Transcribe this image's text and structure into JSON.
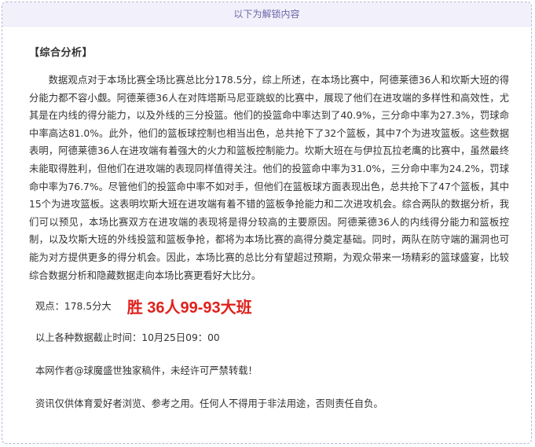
{
  "unlock_banner": "以下为解锁内容",
  "section_title": "【综合分析】",
  "analysis_paragraph": "数据观点对于本场比赛全场比赛总比分178.5分，综上所述，在本场比赛中，阿德莱德36人和坎斯大班的得分能力都不容小觑。阿德莱德36人在对阵塔斯马尼亚跳蚁的比赛中，展现了他们在进攻端的多样性和高效性，尤其是在内线的得分能力，以及外线的三分投篮。他们的投篮命中率达到了40.9%，三分命中率为27.3%，罚球命中率高达81.0%。此外，他们的篮板球控制也相当出色，总共抢下了32个篮板，其中7个为进攻篮板。这些数据表明，阿德莱德36人在进攻端有着强大的火力和篮板控制能力。坎斯大班在与伊拉瓦拉老鹰的比赛中，虽然最终未能取得胜利，但他们在进攻端的表现同样值得关注。他们的投篮命中率为31.0%，三分命中率为24.2%，罚球命中率为76.7%。尽管他们的投篮命中率不如对手，但他们在篮板球方面表现出色，总共抢下了47个篮板，其中15个为进攻篮板。这表明坎斯大班在进攻端有着不错的篮板争抢能力和二次进攻机会。综合两队的数据分析，我们可以预见，本场比赛双方在进攻端的表现将是得分较高的主要原因。阿德莱德36人的内线得分能力和篮板控制，以及坎斯大班的外线投篮和篮板争抢，都将为本场比赛的高得分奠定基础。同时，两队在防守端的漏洞也可能为对方提供更多的得分机会。因此，本场比赛的总比分有望超过预期，为观众带来一场精彩的篮球盛宴，比较综合数据分析和隐藏数据走向本场比赛更看好大比分。",
  "viewpoint_label": "观点：178.5分大",
  "viewpoint_pick": "胜 36人99-93大班",
  "deadline_text": "以上各种数据截止时间：10月25日09：00",
  "copyright_text": "本网作者@球魔盛世独家稿件，未经许可严禁转载！",
  "disclaimer_text": "资讯仅供体育爱好者浏览、参考之用。任何人不得用于非法用途，否则责任自负。",
  "colors": {
    "banner_bg": "#f2f1fb",
    "banner_text": "#6a66a8",
    "pick_red": "#e0201c",
    "body_text": "#333333"
  }
}
